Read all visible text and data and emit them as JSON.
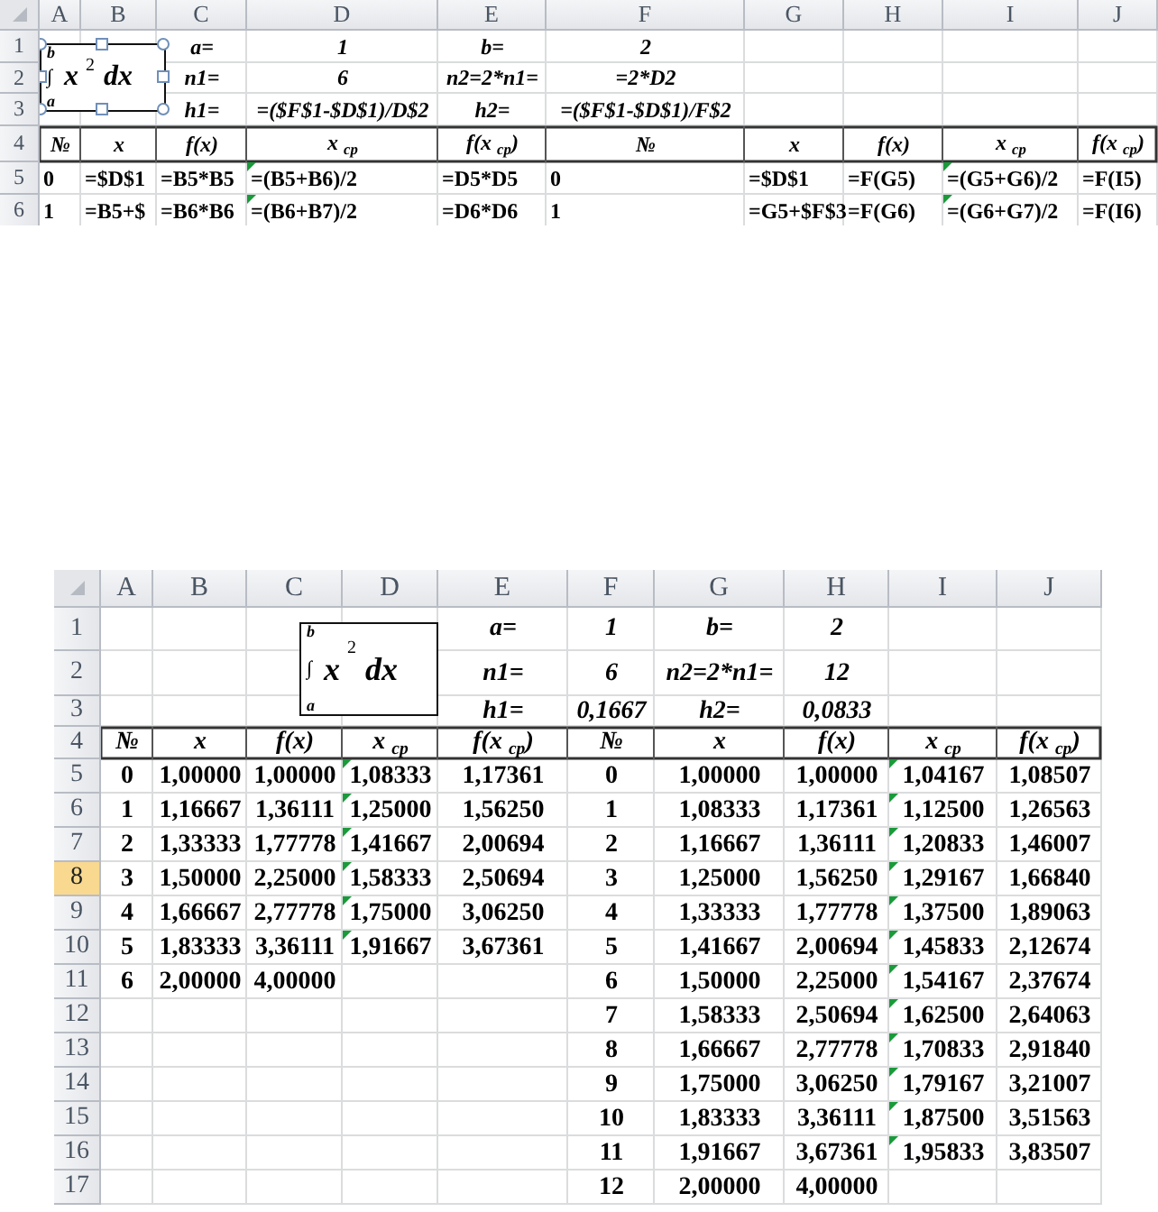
{
  "sheets": [
    {
      "show_formulas": true,
      "columns": [
        "A",
        "B",
        "C",
        "D",
        "E",
        "F",
        "G",
        "H",
        "I",
        "J"
      ],
      "equation": {
        "upper": "b",
        "sign": "∫",
        "lower": "a",
        "body": "x",
        "power": "2",
        "differential": "dx",
        "selected": true
      },
      "rows": [
        {
          "label": "1",
          "selected": false,
          "kind": "params",
          "cells": [
            null,
            null,
            "a=",
            "1",
            "b=",
            "2",
            null,
            null,
            null,
            null
          ]
        },
        {
          "label": "2",
          "selected": false,
          "kind": "params",
          "cells": [
            null,
            null,
            "n1=",
            "6",
            "n2=2*n1=",
            "=2*D2",
            null,
            null,
            null,
            null
          ]
        },
        {
          "label": "3",
          "selected": false,
          "kind": "params",
          "cells": [
            null,
            null,
            "h1=",
            "=($F$1-$D$1)/D$2",
            "h2=",
            "=($F$1-$D$1)/F$2",
            null,
            null,
            null,
            null
          ]
        },
        {
          "label": "4",
          "selected": false,
          "kind": "header",
          "cells": [
            "№",
            "x",
            "f(x)",
            "x $_{ср}$",
            "f(x $_{ср}$)",
            "№",
            "x",
            "f(x)",
            "x $_{ср}$",
            "f(x $_{ср}$)"
          ]
        },
        {
          "label": "5",
          "selected": false,
          "kind": "data",
          "cells": [
            {
              "text": "0",
              "flagged": false
            },
            {
              "text": "=$D$1",
              "flagged": false
            },
            {
              "text": "=B5*B5",
              "flagged": false
            },
            {
              "text": "=(B5+B6)/2",
              "flagged": true
            },
            {
              "text": "=D5*D5",
              "flagged": false
            },
            {
              "text": "0",
              "flagged": false
            },
            {
              "text": "=$D$1",
              "flagged": false
            },
            {
              "text": "=F(G5)",
              "flagged": false
            },
            {
              "text": "=(G5+G6)/2",
              "flagged": true
            },
            {
              "text": "=F(I5)",
              "flagged": false
            }
          ]
        },
        {
          "label": "6",
          "selected": false,
          "kind": "data",
          "cells": [
            {
              "text": "1",
              "flagged": false
            },
            {
              "text": "=B5+$",
              "flagged": false
            },
            {
              "text": "=B6*B6",
              "flagged": false
            },
            {
              "text": "=(B6+B7)/2",
              "flagged": true
            },
            {
              "text": "=D6*D6",
              "flagged": false
            },
            {
              "text": "1",
              "flagged": false
            },
            {
              "text": "=G5+$F$3",
              "flagged": false
            },
            {
              "text": "=F(G6)",
              "flagged": false
            },
            {
              "text": "=(G6+G7)/2",
              "flagged": true
            },
            {
              "text": "=F(I6)",
              "flagged": false
            }
          ]
        }
      ]
    },
    {
      "show_formulas": false,
      "columns": [
        "A",
        "B",
        "C",
        "D",
        "E",
        "F",
        "G",
        "H",
        "I",
        "J"
      ],
      "equation": {
        "upper": "b",
        "sign": "∫",
        "lower": "a",
        "body": "x",
        "power": "2",
        "differential": "dx",
        "selected": false
      },
      "rows": [
        {
          "label": "1",
          "selected": false,
          "kind": "params",
          "cells": [
            null,
            null,
            null,
            null,
            "a=",
            "1",
            "b=",
            "2",
            null,
            null
          ]
        },
        {
          "label": "2",
          "selected": false,
          "kind": "params",
          "cells": [
            null,
            null,
            null,
            null,
            "n1=",
            "6",
            "n2=2*n1=",
            "12",
            null,
            null
          ]
        },
        {
          "label": "3",
          "selected": false,
          "kind": "params",
          "cells": [
            null,
            null,
            null,
            null,
            "h1=",
            "0,1667",
            "h2=",
            "0,0833",
            null,
            null
          ]
        },
        {
          "label": "4",
          "selected": false,
          "kind": "header",
          "cells": [
            "№",
            "x",
            "f(x)",
            "x $_{ср}$",
            "f(x $_{ср}$)",
            "№",
            "x",
            "f(x)",
            "x $_{ср}$",
            "f(x $_{ср}$)"
          ]
        },
        {
          "label": "5",
          "selected": false,
          "kind": "data",
          "cells": [
            {
              "text": "0",
              "flagged": false
            },
            {
              "text": "1,00000",
              "flagged": false
            },
            {
              "text": "1,00000",
              "flagged": false
            },
            {
              "text": "1,08333",
              "flagged": true
            },
            {
              "text": "1,17361",
              "flagged": false
            },
            {
              "text": "0",
              "flagged": false
            },
            {
              "text": "1,00000",
              "flagged": false
            },
            {
              "text": "1,00000",
              "flagged": false
            },
            {
              "text": "1,04167",
              "flagged": true
            },
            {
              "text": "1,08507",
              "flagged": false
            }
          ]
        },
        {
          "label": "6",
          "selected": false,
          "kind": "data",
          "cells": [
            {
              "text": "1",
              "flagged": false
            },
            {
              "text": "1,16667",
              "flagged": false
            },
            {
              "text": "1,36111",
              "flagged": false
            },
            {
              "text": "1,25000",
              "flagged": true
            },
            {
              "text": "1,56250",
              "flagged": false
            },
            {
              "text": "1",
              "flagged": false
            },
            {
              "text": "1,08333",
              "flagged": false
            },
            {
              "text": "1,17361",
              "flagged": false
            },
            {
              "text": "1,12500",
              "flagged": true
            },
            {
              "text": "1,26563",
              "flagged": false
            }
          ]
        },
        {
          "label": "7",
          "selected": false,
          "kind": "data",
          "cells": [
            {
              "text": "2",
              "flagged": false
            },
            {
              "text": "1,33333",
              "flagged": false
            },
            {
              "text": "1,77778",
              "flagged": false
            },
            {
              "text": "1,41667",
              "flagged": true
            },
            {
              "text": "2,00694",
              "flagged": false
            },
            {
              "text": "2",
              "flagged": false
            },
            {
              "text": "1,16667",
              "flagged": false
            },
            {
              "text": "1,36111",
              "flagged": false
            },
            {
              "text": "1,20833",
              "flagged": true
            },
            {
              "text": "1,46007",
              "flagged": false
            }
          ]
        },
        {
          "label": "8",
          "selected": true,
          "kind": "data",
          "cells": [
            {
              "text": "3",
              "flagged": false
            },
            {
              "text": "1,50000",
              "flagged": false
            },
            {
              "text": "2,25000",
              "flagged": false
            },
            {
              "text": "1,58333",
              "flagged": true
            },
            {
              "text": "2,50694",
              "flagged": false
            },
            {
              "text": "3",
              "flagged": false
            },
            {
              "text": "1,25000",
              "flagged": false
            },
            {
              "text": "1,56250",
              "flagged": false
            },
            {
              "text": "1,29167",
              "flagged": true
            },
            {
              "text": "1,66840",
              "flagged": false
            }
          ]
        },
        {
          "label": "9",
          "selected": false,
          "kind": "data",
          "cells": [
            {
              "text": "4",
              "flagged": false
            },
            {
              "text": "1,66667",
              "flagged": false
            },
            {
              "text": "2,77778",
              "flagged": false
            },
            {
              "text": "1,75000",
              "flagged": true
            },
            {
              "text": "3,06250",
              "flagged": false
            },
            {
              "text": "4",
              "flagged": false
            },
            {
              "text": "1,33333",
              "flagged": false
            },
            {
              "text": "1,77778",
              "flagged": false
            },
            {
              "text": "1,37500",
              "flagged": true
            },
            {
              "text": "1,89063",
              "flagged": false
            }
          ]
        },
        {
          "label": "10",
          "selected": false,
          "kind": "data",
          "cells": [
            {
              "text": "5",
              "flagged": false
            },
            {
              "text": "1,83333",
              "flagged": false
            },
            {
              "text": "3,36111",
              "flagged": false
            },
            {
              "text": "1,91667",
              "flagged": true
            },
            {
              "text": "3,67361",
              "flagged": false
            },
            {
              "text": "5",
              "flagged": false
            },
            {
              "text": "1,41667",
              "flagged": false
            },
            {
              "text": "2,00694",
              "flagged": false
            },
            {
              "text": "1,45833",
              "flagged": true
            },
            {
              "text": "2,12674",
              "flagged": false
            }
          ]
        },
        {
          "label": "11",
          "selected": false,
          "kind": "data",
          "cells": [
            {
              "text": "6",
              "flagged": false
            },
            {
              "text": "2,00000",
              "flagged": false
            },
            {
              "text": "4,00000",
              "flagged": false
            },
            null,
            null,
            {
              "text": "6",
              "flagged": false
            },
            {
              "text": "1,50000",
              "flagged": false
            },
            {
              "text": "2,25000",
              "flagged": false
            },
            {
              "text": "1,54167",
              "flagged": true
            },
            {
              "text": "2,37674",
              "flagged": false
            }
          ]
        },
        {
          "label": "12",
          "selected": false,
          "kind": "data",
          "cells": [
            null,
            null,
            null,
            null,
            null,
            {
              "text": "7",
              "flagged": false
            },
            {
              "text": "1,58333",
              "flagged": false
            },
            {
              "text": "2,50694",
              "flagged": false
            },
            {
              "text": "1,62500",
              "flagged": true
            },
            {
              "text": "2,64063",
              "flagged": false
            }
          ]
        },
        {
          "label": "13",
          "selected": false,
          "kind": "data",
          "cells": [
            null,
            null,
            null,
            null,
            null,
            {
              "text": "8",
              "flagged": false
            },
            {
              "text": "1,66667",
              "flagged": false
            },
            {
              "text": "2,77778",
              "flagged": false
            },
            {
              "text": "1,70833",
              "flagged": true
            },
            {
              "text": "2,91840",
              "flagged": false
            }
          ]
        },
        {
          "label": "14",
          "selected": false,
          "kind": "data",
          "cells": [
            null,
            null,
            null,
            null,
            null,
            {
              "text": "9",
              "flagged": false
            },
            {
              "text": "1,75000",
              "flagged": false
            },
            {
              "text": "3,06250",
              "flagged": false
            },
            {
              "text": "1,79167",
              "flagged": true
            },
            {
              "text": "3,21007",
              "flagged": false
            }
          ]
        },
        {
          "label": "15",
          "selected": false,
          "kind": "data",
          "cells": [
            null,
            null,
            null,
            null,
            null,
            {
              "text": "10",
              "flagged": false
            },
            {
              "text": "1,83333",
              "flagged": false
            },
            {
              "text": "3,36111",
              "flagged": false
            },
            {
              "text": "1,87500",
              "flagged": true
            },
            {
              "text": "3,51563",
              "flagged": false
            }
          ]
        },
        {
          "label": "16",
          "selected": false,
          "kind": "data",
          "cells": [
            null,
            null,
            null,
            null,
            null,
            {
              "text": "11",
              "flagged": false
            },
            {
              "text": "1,91667",
              "flagged": false
            },
            {
              "text": "3,67361",
              "flagged": false
            },
            {
              "text": "1,95833",
              "flagged": true
            },
            {
              "text": "3,83507",
              "flagged": false
            }
          ]
        },
        {
          "label": "17",
          "selected": false,
          "kind": "data",
          "cells": [
            null,
            null,
            null,
            null,
            null,
            {
              "text": "12",
              "flagged": false
            },
            {
              "text": "2,00000",
              "flagged": false
            },
            {
              "text": "4,00000",
              "flagged": false
            },
            null,
            null
          ]
        }
      ]
    }
  ]
}
